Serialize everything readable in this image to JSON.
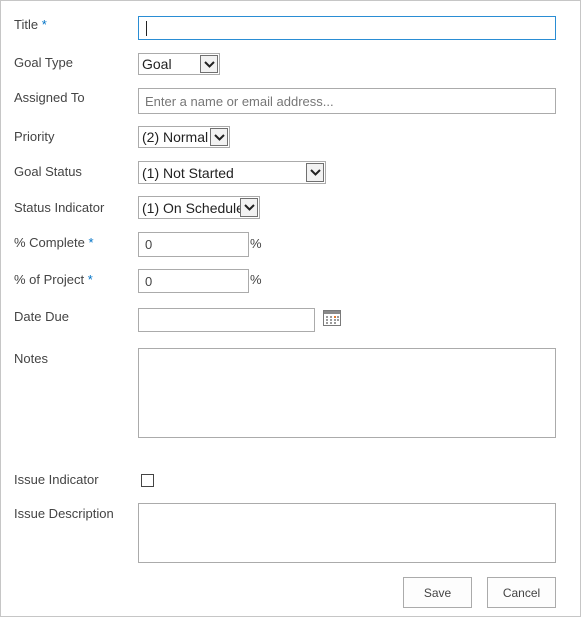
{
  "form": {
    "title": {
      "label": "Title",
      "required_mark": "*",
      "value": ""
    },
    "goal_type": {
      "label": "Goal Type",
      "selected": "Goal"
    },
    "assigned_to": {
      "label": "Assigned To",
      "placeholder": "Enter a name or email address..."
    },
    "priority": {
      "label": "Priority",
      "selected": "(2) Normal"
    },
    "goal_status": {
      "label": "Goal Status",
      "selected": "(1) Not Started"
    },
    "status_indicator": {
      "label": "Status Indicator",
      "selected": "(1) On Schedule"
    },
    "percent_complete": {
      "label": "% Complete",
      "required_mark": "*",
      "value": "0",
      "unit": "%"
    },
    "percent_of_project": {
      "label": "% of Project",
      "required_mark": "*",
      "value": "0",
      "unit": "%"
    },
    "date_due": {
      "label": "Date Due",
      "value": "",
      "picker_icon": "calendar-icon"
    },
    "notes": {
      "label": "Notes",
      "value": ""
    },
    "issue_indicator": {
      "label": "Issue Indicator",
      "checked": false
    },
    "issue_description": {
      "label": "Issue Description",
      "value": ""
    }
  },
  "buttons": {
    "save_label": "Save",
    "cancel_label": "Cancel"
  },
  "colors": {
    "required_mark": "#0072c6",
    "focus_border": "#2a8dd4",
    "input_border": "#ababab"
  }
}
